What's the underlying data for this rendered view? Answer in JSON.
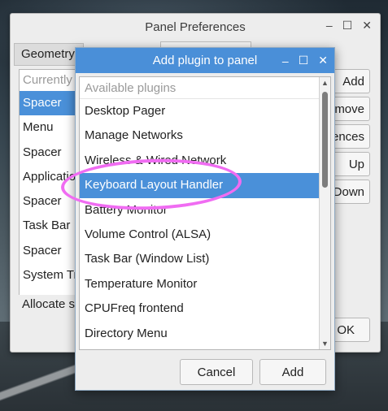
{
  "background": {
    "desktop": "wallpaper"
  },
  "panel_prefs": {
    "title": "Panel Preferences",
    "minimize": "–",
    "maximize": "☐",
    "close": "✕",
    "tab_geometry": "Geometry",
    "list_header": "Currently loaded plugins",
    "items": [
      "Spacer",
      "Menu",
      "Spacer",
      "Application Launch Bar",
      "Spacer",
      "Task Bar",
      "Spacer",
      "System Tray"
    ],
    "selected_index": 0,
    "footer": "Allocate space",
    "buttons": [
      "Add",
      "Remove",
      "Preferences",
      "Up",
      "Down"
    ],
    "ok": "OK"
  },
  "dialog": {
    "title": "Add plugin to panel",
    "minimize": "–",
    "maximize": "☐",
    "close": "✕",
    "list_header": "Available plugins",
    "items": [
      "Desktop Pager",
      "Manage Networks",
      "Wireless & Wired Network",
      "Keyboard Layout Handler",
      "Battery Monitor",
      "Volume Control (ALSA)",
      "Task Bar (Window List)",
      "Temperature Monitor",
      "CPUFreq frontend",
      "Directory Menu"
    ],
    "selected_index": 3,
    "cancel": "Cancel",
    "add": "Add"
  },
  "colors": {
    "accent": "#4a90d9",
    "annotation": "#f06cf2"
  }
}
